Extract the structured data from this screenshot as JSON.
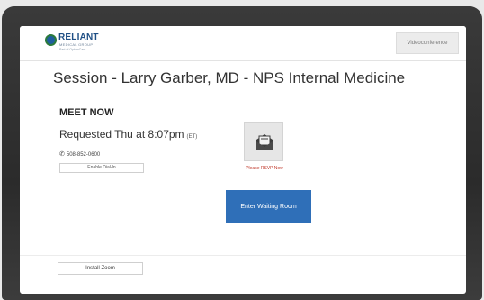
{
  "header": {
    "logo": {
      "name": "RELIANT",
      "subtitle": "MEDICAL GROUP",
      "tagline": "Part of OptumCare"
    },
    "videoconference_label": "Videoconference"
  },
  "session": {
    "title": "Session - Larry Garber, MD - NPS Internal Medicine",
    "section_heading": "MEET NOW",
    "requested_text": "Requested Thu at 8:07pm",
    "timezone": "(ET)",
    "phone": "508-852-0600",
    "dial_in_label": "Enable Dial-In"
  },
  "rsvp": {
    "icon": "envelope-icon",
    "label": "Please RSVP Now"
  },
  "actions": {
    "waiting_room_label": "Enter Waiting Room",
    "install_zoom_label": "Install Zoom"
  },
  "colors": {
    "primary_button": "#2f6fb8",
    "rsvp_text": "#c0392b",
    "bezel": "#2b2b2b"
  }
}
